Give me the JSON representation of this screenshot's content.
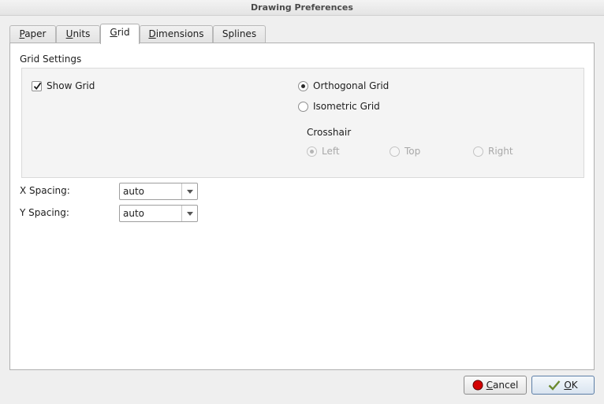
{
  "window": {
    "title": "Drawing Preferences"
  },
  "tabs": [
    {
      "pre": "",
      "mnemonic": "P",
      "post": "aper",
      "active": false
    },
    {
      "pre": "",
      "mnemonic": "U",
      "post": "nits",
      "active": false
    },
    {
      "pre": "",
      "mnemonic": "G",
      "post": "rid",
      "active": true
    },
    {
      "pre": "",
      "mnemonic": "D",
      "post": "imensions",
      "active": false
    },
    {
      "pre": "",
      "mnemonic": "",
      "post": "Splines",
      "active": false
    }
  ],
  "grid_settings": {
    "title": "Grid Settings",
    "show_grid": {
      "label": "Show Grid",
      "checked": true
    },
    "orthogonal": {
      "label": "Orthogonal Grid",
      "selected": true
    },
    "isometric": {
      "label": "Isometric Grid",
      "selected": false
    },
    "crosshair": {
      "title": "Crosshair",
      "options": [
        {
          "label": "Left",
          "selected": true,
          "enabled": false
        },
        {
          "label": "Top",
          "selected": false,
          "enabled": false
        },
        {
          "label": "Right",
          "selected": false,
          "enabled": false
        }
      ]
    }
  },
  "spacing": {
    "x": {
      "label": "X Spacing:",
      "value": "auto"
    },
    "y": {
      "label": "Y Spacing:",
      "value": "auto"
    }
  },
  "buttons": {
    "cancel": {
      "mnemonic": "C",
      "rest": "ancel",
      "icon": "cancel-icon",
      "icon_color": "#d40000"
    },
    "ok": {
      "mnemonic": "O",
      "rest": "K",
      "icon": "ok-check-icon",
      "icon_color": "#6b8a2f"
    }
  }
}
